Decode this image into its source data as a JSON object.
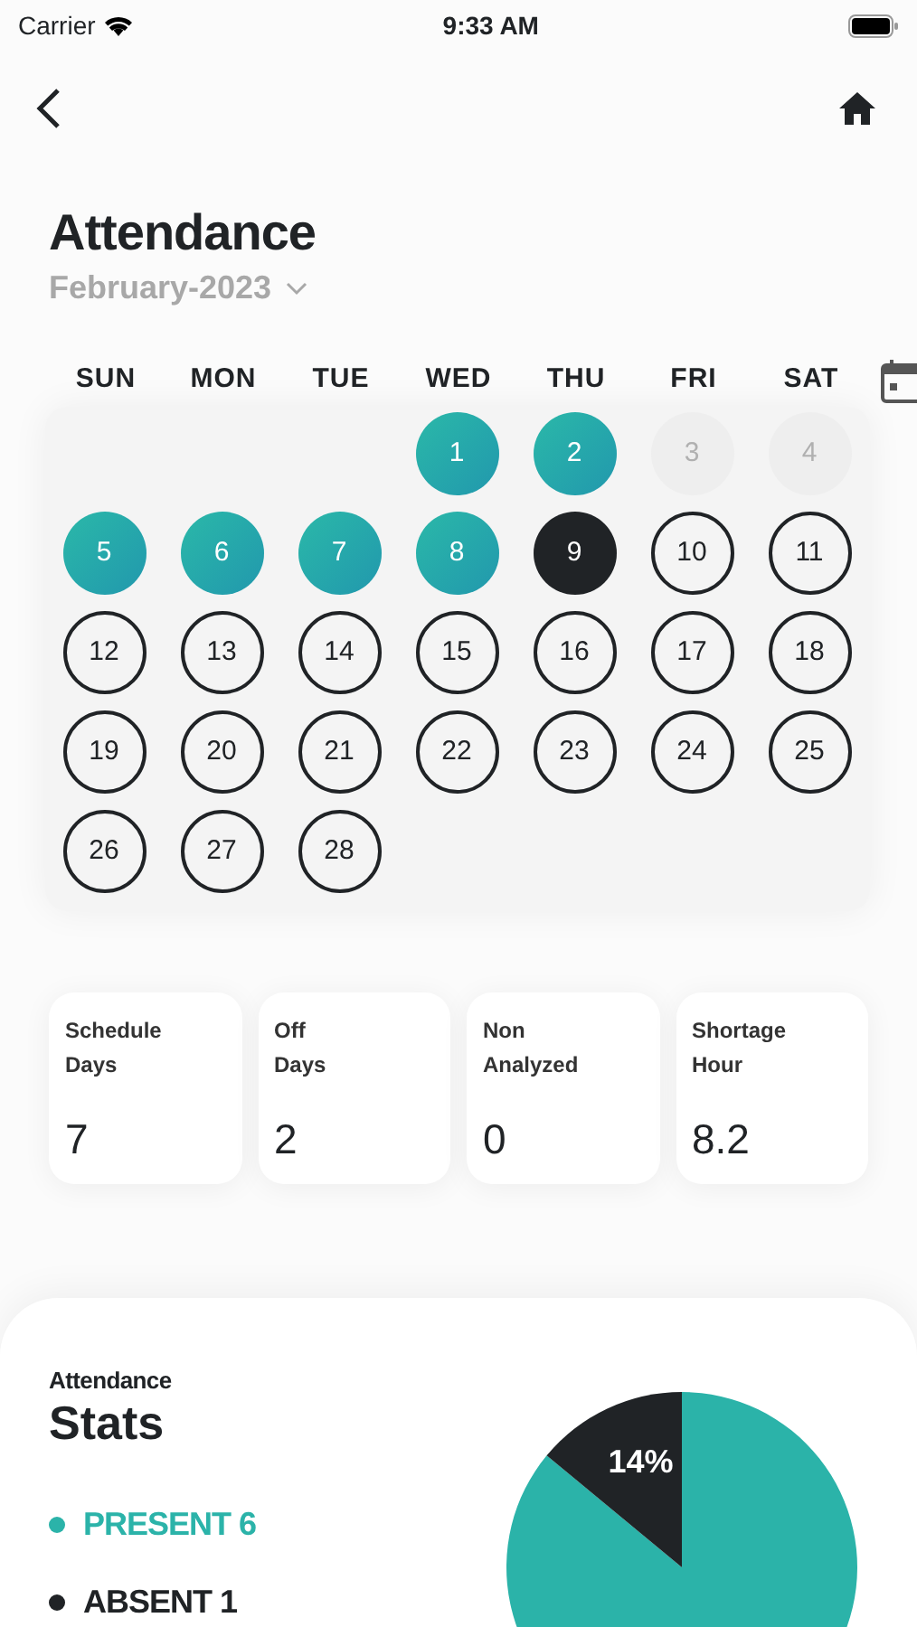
{
  "status_bar": {
    "carrier": "Carrier",
    "time": "9:33 AM"
  },
  "title": "Attendance",
  "month": "February-2023",
  "weekdays": [
    "SUN",
    "MON",
    "TUE",
    "WED",
    "THU",
    "FRI",
    "SAT"
  ],
  "weeks": [
    [
      {
        "label": "1",
        "kind": "present"
      },
      {
        "label": "2",
        "kind": "present"
      },
      {
        "label": "3",
        "kind": "off"
      },
      {
        "label": "4",
        "kind": "off"
      }
    ],
    [
      {
        "label": "5",
        "kind": "present"
      },
      {
        "label": "6",
        "kind": "present"
      },
      {
        "label": "7",
        "kind": "present"
      },
      {
        "label": "8",
        "kind": "present"
      },
      {
        "label": "9",
        "kind": "today"
      },
      {
        "label": "10",
        "kind": "upcoming"
      },
      {
        "label": "11",
        "kind": "upcoming"
      }
    ],
    [
      {
        "label": "12",
        "kind": "upcoming"
      },
      {
        "label": "13",
        "kind": "upcoming"
      },
      {
        "label": "14",
        "kind": "upcoming"
      },
      {
        "label": "15",
        "kind": "upcoming"
      },
      {
        "label": "16",
        "kind": "upcoming"
      },
      {
        "label": "17",
        "kind": "upcoming"
      },
      {
        "label": "18",
        "kind": "upcoming"
      }
    ],
    [
      {
        "label": "19",
        "kind": "upcoming"
      },
      {
        "label": "20",
        "kind": "upcoming"
      },
      {
        "label": "21",
        "kind": "upcoming"
      },
      {
        "label": "22",
        "kind": "upcoming"
      },
      {
        "label": "23",
        "kind": "upcoming"
      },
      {
        "label": "24",
        "kind": "upcoming"
      },
      {
        "label": "25",
        "kind": "upcoming"
      }
    ],
    [
      {
        "label": "26",
        "kind": "upcoming"
      },
      {
        "label": "27",
        "kind": "upcoming"
      },
      {
        "label": "28",
        "kind": "upcoming"
      }
    ]
  ],
  "summary": [
    {
      "label": [
        "Schedule",
        "Days"
      ],
      "value": "7"
    },
    {
      "label": [
        "Off",
        "Days"
      ],
      "value": "2"
    },
    {
      "label": [
        "Non",
        "Analyzed"
      ],
      "value": "0"
    },
    {
      "label": [
        "Shortage",
        "Hour"
      ],
      "value": "8.2"
    }
  ],
  "stats": {
    "subtitle": "Attendance",
    "title": "Stats",
    "legend": [
      {
        "label": "PRESENT 6",
        "color": "#2bb3a9"
      },
      {
        "label": "ABSENT 1",
        "color": "#202326"
      }
    ],
    "chart_data": {
      "type": "pie",
      "series": [
        {
          "values": [
            86,
            14
          ]
        }
      ],
      "colors": [
        "#2bb3a9",
        "#202326"
      ],
      "value_labels": [
        null,
        "14%"
      ]
    }
  }
}
